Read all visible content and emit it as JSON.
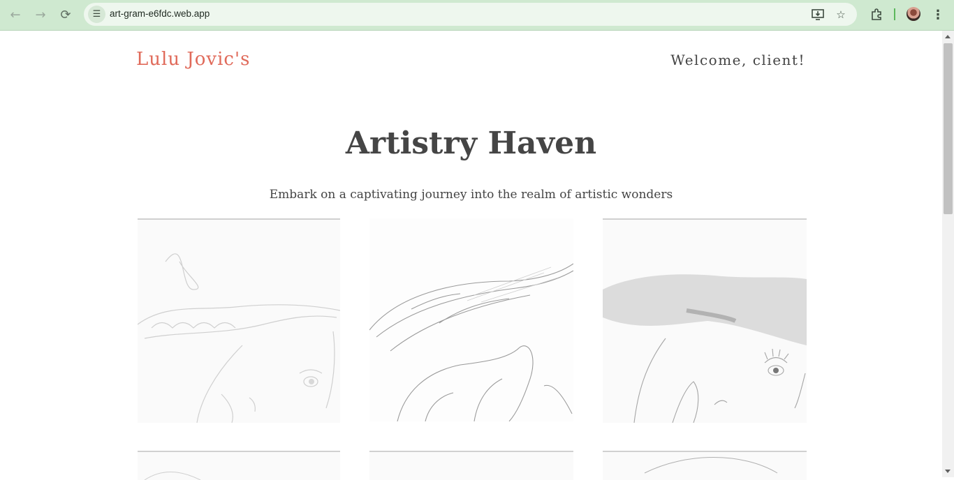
{
  "browser": {
    "url": "art-gram-e6fdc.web.app",
    "icons": [
      "back-arrow-icon",
      "forward-arrow-icon",
      "reload-icon",
      "site-info-icon",
      "install-app-icon",
      "bookmark-star-icon",
      "extensions-icon",
      "profile-avatar",
      "more-menu-icon"
    ]
  },
  "header": {
    "brand": "Lulu Jovic's",
    "welcome": "Welcome, client!"
  },
  "hero": {
    "title": "Artistry Haven",
    "subtitle": "Embark on a captivating journey into the realm of artistic wonders"
  },
  "gallery": {
    "items": [
      {
        "subject": "pencil sketch of a face with braided hair"
      },
      {
        "subject": "pencil sketch of flowing hair and hands"
      },
      {
        "subject": "pencil sketch of a face with dark hair"
      },
      {
        "subject": "pencil sketch"
      },
      {
        "subject": "pencil sketch"
      },
      {
        "subject": "pencil sketch"
      }
    ]
  },
  "colors": {
    "brand": "#e06a5a",
    "text": "#444444",
    "chrome": "#cfe9d0"
  }
}
